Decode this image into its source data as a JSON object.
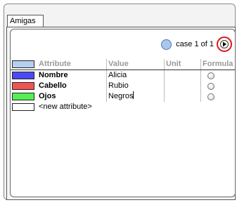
{
  "window": {
    "tab_label": "Amigas"
  },
  "nav": {
    "case_label": "case 1 of 1",
    "case_color": "#a9c8ee"
  },
  "table": {
    "headers": {
      "attribute": "Attribute",
      "value": "Value",
      "unit": "Unit",
      "formula": "Formula"
    },
    "header_swatch_color": "#b5cff0",
    "rows": [
      {
        "name": "Nombre",
        "value": "Alicia",
        "unit": "",
        "color": "#4a4af5"
      },
      {
        "name": "Cabello",
        "value": "Rubio",
        "unit": "",
        "color": "#f25454"
      },
      {
        "name": "Ojos",
        "value": "Negros",
        "unit": "",
        "color": "#55ee55"
      }
    ],
    "new_attribute_label": "<new attribute>"
  }
}
